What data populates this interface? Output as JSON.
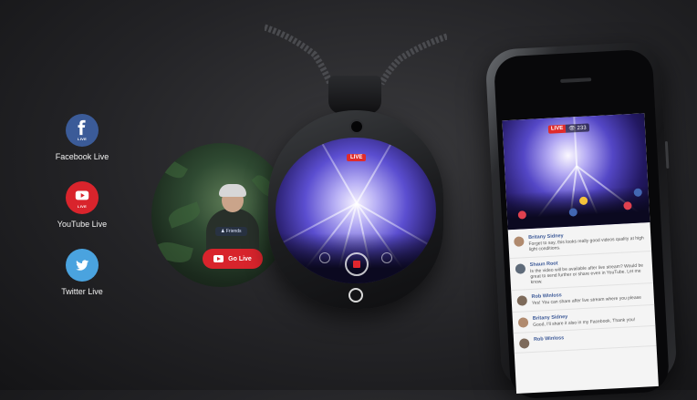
{
  "platforms": [
    {
      "label": "Facebook Live",
      "badge": "LIVE",
      "icon": "facebook-icon",
      "color": "#3b5b98"
    },
    {
      "label": "YouTube Live",
      "badge": "LIVE",
      "icon": "youtube-icon",
      "color": "#d9242c"
    },
    {
      "label": "Twitter Live",
      "badge": "",
      "icon": "twitter-icon",
      "color": "#4aa3df"
    }
  ],
  "preview": {
    "friends_label": "Friends",
    "go_live_label": "Go Live"
  },
  "device": {
    "live_tag": "LIVE"
  },
  "phone": {
    "live_tag": "LIVE",
    "viewers": "233",
    "comments": [
      {
        "name": "Britany Sidney",
        "text": "Forget to say, this looks really good videos quality at high light conditions."
      },
      {
        "name": "Shaun Root",
        "text": "Is the video will be available after live stream? Would be great to send further or share even in YouTube. Let me know."
      },
      {
        "name": "Rob Winloss",
        "text": "Yes! You can share after live stream where you please"
      },
      {
        "name": "Britany Sidney",
        "text": "Good, I'll share it also in my Facebook. Thank you!"
      },
      {
        "name": "Rob Winloss",
        "text": ""
      }
    ]
  },
  "colors": {
    "live_red": "#e02b2b",
    "background": "#232326"
  }
}
